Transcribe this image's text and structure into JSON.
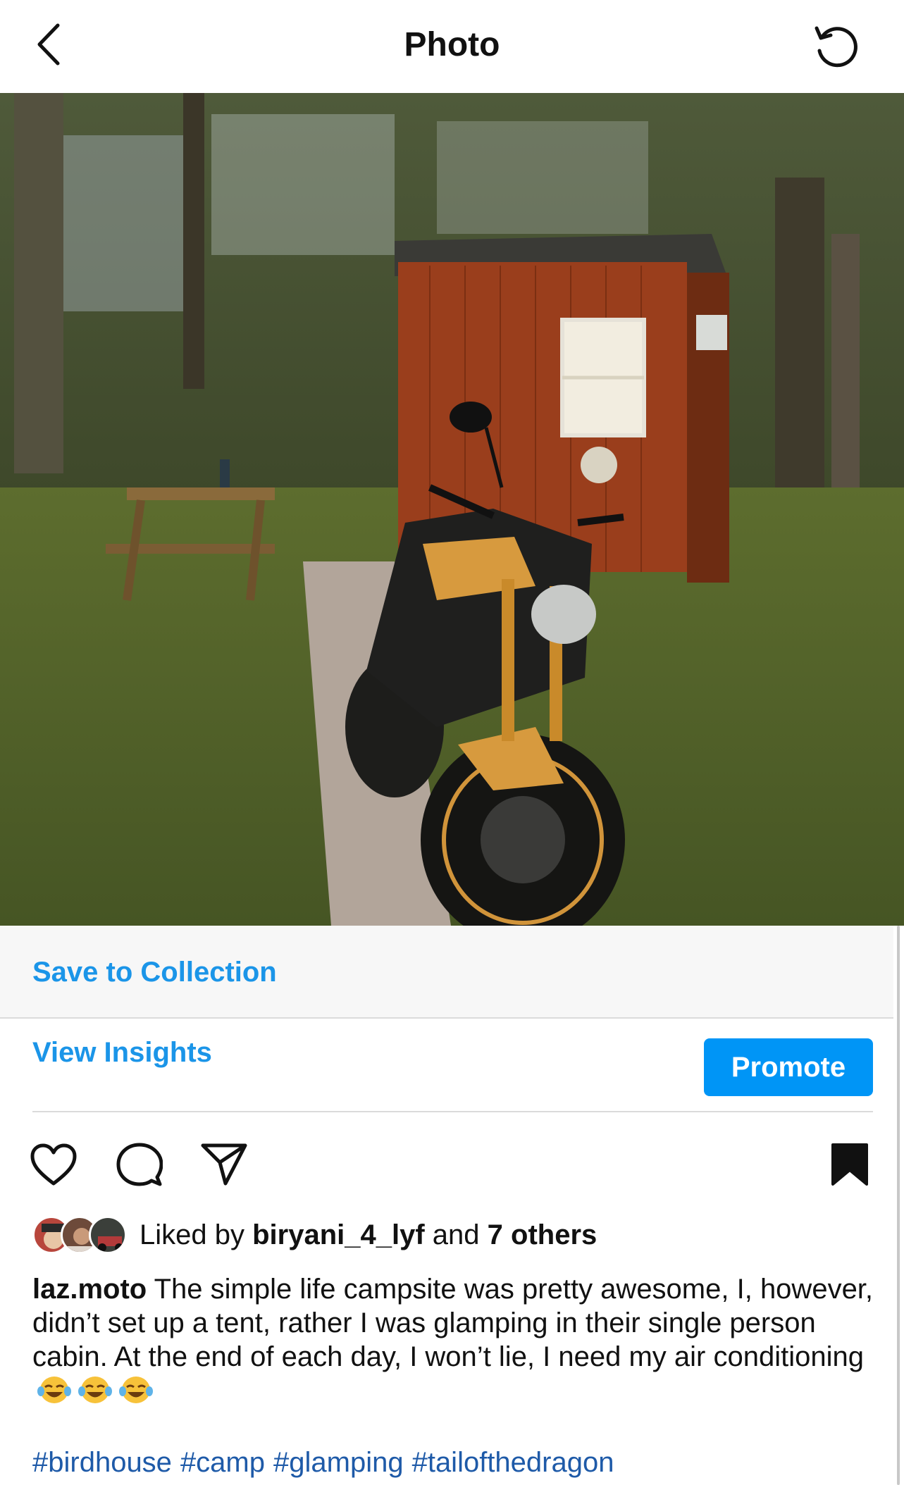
{
  "header": {
    "title": "Photo",
    "back_icon": "chevron-left-icon",
    "refresh_icon": "refresh-icon"
  },
  "photo": {
    "description_icon": "post-photo"
  },
  "save_strip": {
    "label": "Save to Collection"
  },
  "insights": {
    "view_label": "View Insights",
    "promote_label": "Promote"
  },
  "actions": {
    "like_icon": "heart-icon",
    "comment_icon": "comment-icon",
    "share_icon": "send-icon",
    "save_icon": "bookmark-icon"
  },
  "likes": {
    "prefix": "Liked by ",
    "user": "biryani_4_lyf",
    "middle": " and ",
    "others": "7 others"
  },
  "caption": {
    "username": "laz.moto",
    "text": " The simple life campsite was pretty awesome, I, however, didn’t set up a tent, rather I was glamping in their single person cabin. At the end of each day, I won’t lie, I need my air conditioning"
  },
  "hashtags": [
    "#birdhouse",
    "#camp",
    "#glamping",
    "#tailofthedragon"
  ],
  "colors": {
    "link_blue": "#1b95e8",
    "promote_blue": "#0095f6",
    "hashtag_blue": "#1e5aa8"
  }
}
